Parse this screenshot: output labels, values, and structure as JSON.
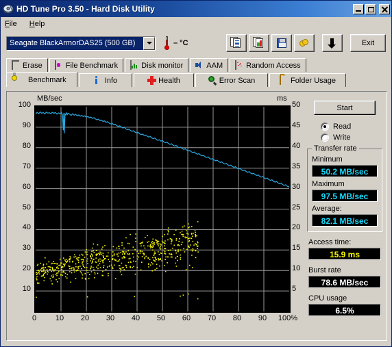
{
  "window": {
    "title": "HD Tune Pro 3.50 - Hard Disk Utility",
    "icon": "hdd-icon",
    "buttons": {
      "minimize": "minimize-button",
      "maximize": "maximize-button",
      "close": "close-button"
    }
  },
  "menu": {
    "items": [
      {
        "label": "File",
        "accel": "F"
      },
      {
        "label": "Help",
        "accel": "H"
      }
    ]
  },
  "toolbar": {
    "drive_selected": "Seagate BlackArmorDAS25 (500 GB)",
    "temperature": "– °C",
    "buttons": [
      {
        "name": "copy-text-button",
        "icon": "copy-document-icon",
        "label": ""
      },
      {
        "name": "copy-image-button",
        "icon": "copy-image-icon",
        "label": ""
      },
      {
        "name": "save-button",
        "icon": "floppy-disk-icon",
        "label": ""
      },
      {
        "name": "options-button",
        "icon": "coins-icon",
        "label": ""
      },
      {
        "name": "download-button",
        "icon": "down-arrow-icon",
        "label": ""
      },
      {
        "name": "exit-button",
        "icon": "",
        "label": "Exit"
      }
    ]
  },
  "tabs": {
    "row1": [
      {
        "label": "Erase",
        "icon": "trash-icon",
        "active": false
      },
      {
        "label": "File Benchmark",
        "icon": "file-benchmark-icon",
        "active": false
      },
      {
        "label": "Disk monitor",
        "icon": "bar-chart-icon",
        "active": false
      },
      {
        "label": "AAM",
        "icon": "speaker-icon",
        "active": false
      },
      {
        "label": "Random Access",
        "icon": "random-dots-icon",
        "active": false
      }
    ],
    "row2": [
      {
        "label": "Benchmark",
        "icon": "lightbulb-icon",
        "active": true
      },
      {
        "label": "Info",
        "icon": "info-icon",
        "active": false
      },
      {
        "label": "Health",
        "icon": "red-cross-icon",
        "active": false
      },
      {
        "label": "Error Scan",
        "icon": "magnifier-icon",
        "active": false
      },
      {
        "label": "Folder Usage",
        "icon": "folder-icon",
        "active": false
      }
    ]
  },
  "panel": {
    "start_label": "Start",
    "mode": {
      "read_label": "Read",
      "write_label": "Write",
      "selected": "Read"
    },
    "transfer_rate": {
      "legend": "Transfer rate",
      "minimum_label": "Minimum",
      "minimum_value": "50.2 MB/sec",
      "maximum_label": "Maximum",
      "maximum_value": "97.5 MB/sec",
      "average_label": "Average:",
      "average_value": "82.1 MB/sec"
    },
    "access_time_label": "Access time:",
    "access_time_value": "15.9 ms",
    "burst_rate_label": "Burst rate",
    "burst_rate_value": "78.6 MB/sec",
    "cpu_usage_label": "CPU usage",
    "cpu_usage_value": "6.5%"
  },
  "colors": {
    "transfer_curve": "#29a8e0",
    "access_points": "#f2f200",
    "plot_background": "#000000",
    "grid": "#9a9a9a",
    "value_cyan": "#18d8f8",
    "value_yellow": "#f8f800",
    "value_white": "#ffffff",
    "titlebar": "#0a246a",
    "face": "#d4d0c8"
  },
  "chart_data": {
    "type": "line",
    "title": "",
    "xlabel": "100%",
    "ylabel": "MB/sec",
    "y2label": "ms",
    "xlim": [
      0,
      100
    ],
    "ylim": [
      0,
      100
    ],
    "y2lim": [
      0,
      50
    ],
    "grid": true,
    "xticks": [
      0,
      10,
      20,
      30,
      40,
      50,
      60,
      70,
      80,
      90,
      100
    ],
    "xticklabels": [
      "0",
      "10",
      "20",
      "30",
      "40",
      "50",
      "60",
      "70",
      "80",
      "90",
      "100%"
    ],
    "yticks": [
      10,
      20,
      30,
      40,
      50,
      60,
      70,
      80,
      90,
      100
    ],
    "y2ticks": [
      5,
      10,
      15,
      20,
      25,
      30,
      35,
      40,
      45,
      50
    ],
    "series": [
      {
        "name": "Transfer rate",
        "axis": "left",
        "unit": "MB/sec",
        "color": "#29a8e0",
        "x": [
          0,
          0.6,
          1.2,
          1.8,
          2.4,
          3,
          3.6,
          4.2,
          4.8,
          5.4,
          6,
          6.6,
          7.2,
          7.8,
          8.4,
          9,
          9.6,
          10.2,
          10.6,
          10.9,
          11.1,
          11.3,
          11.6,
          11.9,
          12.2,
          12.5,
          12.8,
          13.4,
          14,
          14.6,
          15.2,
          15.8,
          16.4,
          17,
          17.6,
          18.2,
          18.8,
          19.4,
          20,
          20.6,
          21.2,
          21.8,
          22.4,
          23,
          23.6,
          24.2,
          24.8,
          25.4,
          26,
          26.6,
          27.2,
          27.8,
          28.4,
          29,
          29.6,
          30.2,
          30.8,
          31.4,
          32,
          32.6,
          33.2,
          33.8,
          34.4,
          35,
          35.6,
          36.2,
          36.8,
          37.4,
          38,
          38.6,
          39.2,
          39.8,
          40.4,
          41,
          41.6,
          42.2,
          42.8,
          43.4,
          44,
          44.6,
          45.2,
          45.8,
          46.4,
          47,
          47.6,
          48.2,
          48.8,
          49.4,
          50,
          50.6,
          51.2,
          51.8,
          52.4,
          53,
          53.6,
          54.2,
          54.8,
          55.4,
          56,
          56.6,
          57.2,
          57.8,
          58.4,
          59,
          59.6,
          60.2,
          60.8,
          61.4,
          62,
          62.6,
          63.2,
          63.8,
          64.4,
          65,
          65.6,
          66.2,
          66.8,
          67.4,
          68,
          68.6,
          69.2,
          69.8,
          70.4,
          71,
          71.6,
          72.2,
          72.8,
          73.4,
          74,
          74.6,
          75.2,
          75.8,
          76.4,
          77,
          77.6,
          78.2,
          78.8,
          79.4,
          80,
          80.6,
          81.2,
          81.8,
          82.4,
          83,
          83.6,
          84.2,
          84.8,
          85.4,
          86,
          86.6,
          87.2,
          87.8,
          88.4,
          89,
          89.6,
          90.2,
          90.8,
          91.4,
          92,
          92.6,
          93.2,
          93.8,
          94.4,
          95,
          95.6,
          96.2,
          96.8,
          97.4,
          98,
          98.6,
          99.2,
          99.8,
          100
        ],
        "y": [
          96.5,
          97.3,
          96.6,
          97.5,
          96.8,
          97.2,
          96.5,
          97.4,
          96.9,
          97.1,
          96.6,
          97.3,
          96.8,
          97.2,
          96.4,
          97.0,
          96.7,
          97.2,
          96.0,
          88.5,
          96.9,
          87.0,
          96.5,
          96.0,
          97.0,
          96.2,
          96.8,
          96.4,
          95.8,
          96.6,
          95.9,
          96.3,
          95.6,
          96.0,
          95.4,
          95.8,
          95.2,
          95.6,
          94.9,
          95.3,
          94.6,
          95.0,
          94.3,
          94.7,
          94.0,
          93.6,
          93.9,
          93.2,
          93.5,
          92.8,
          93.1,
          92.4,
          92.7,
          92.0,
          91.6,
          91.9,
          91.2,
          91.5,
          90.8,
          90.4,
          90.7,
          90.0,
          89.6,
          89.9,
          89.2,
          88.8,
          89.1,
          88.4,
          88.0,
          88.3,
          87.6,
          87.2,
          87.5,
          86.8,
          86.4,
          86.7,
          86.0,
          86.2,
          85.6,
          85.2,
          85.5,
          84.8,
          84.4,
          84.7,
          84.0,
          83.6,
          83.9,
          83.2,
          83.5,
          82.8,
          82.4,
          82.7,
          82.0,
          81.6,
          81.9,
          81.2,
          80.8,
          81.1,
          80.4,
          80.0,
          80.3,
          79.6,
          79.2,
          79.5,
          78.8,
          78.4,
          78.7,
          78.0,
          77.6,
          77.9,
          77.2,
          76.8,
          77.1,
          76.4,
          76.0,
          76.3,
          75.6,
          75.2,
          75.5,
          74.8,
          74.4,
          74.7,
          74.0,
          73.6,
          73.9,
          73.2,
          72.8,
          73.1,
          72.4,
          72.0,
          72.3,
          71.6,
          71.2,
          71.5,
          70.8,
          70.4,
          70.7,
          70.0,
          69.6,
          69.9,
          69.2,
          68.8,
          69.1,
          68.4,
          68.0,
          68.3,
          67.6,
          67.2,
          67.5,
          66.8,
          66.4,
          66.7,
          66.0,
          65.6,
          65.9,
          65.2,
          64.8,
          65.1,
          64.4,
          64.0,
          64.3,
          63.6,
          63.2,
          63.5,
          62.8,
          62.4,
          62.7,
          62.0,
          61.6,
          61.9,
          61.2,
          60.8,
          61.1,
          60.4,
          60.0,
          59.4,
          58.8,
          58.2,
          57.4,
          56.6,
          55.8,
          54.8,
          53.8,
          52.8,
          51.8,
          50.8,
          50.2
        ]
      },
      {
        "name": "Access time",
        "axis": "right",
        "unit": "ms",
        "color": "#f2f200",
        "type": "scatter",
        "x_range": [
          0,
          64
        ],
        "y_range": [
          4,
          22
        ],
        "average": 15.9,
        "point_count": 620
      }
    ]
  }
}
